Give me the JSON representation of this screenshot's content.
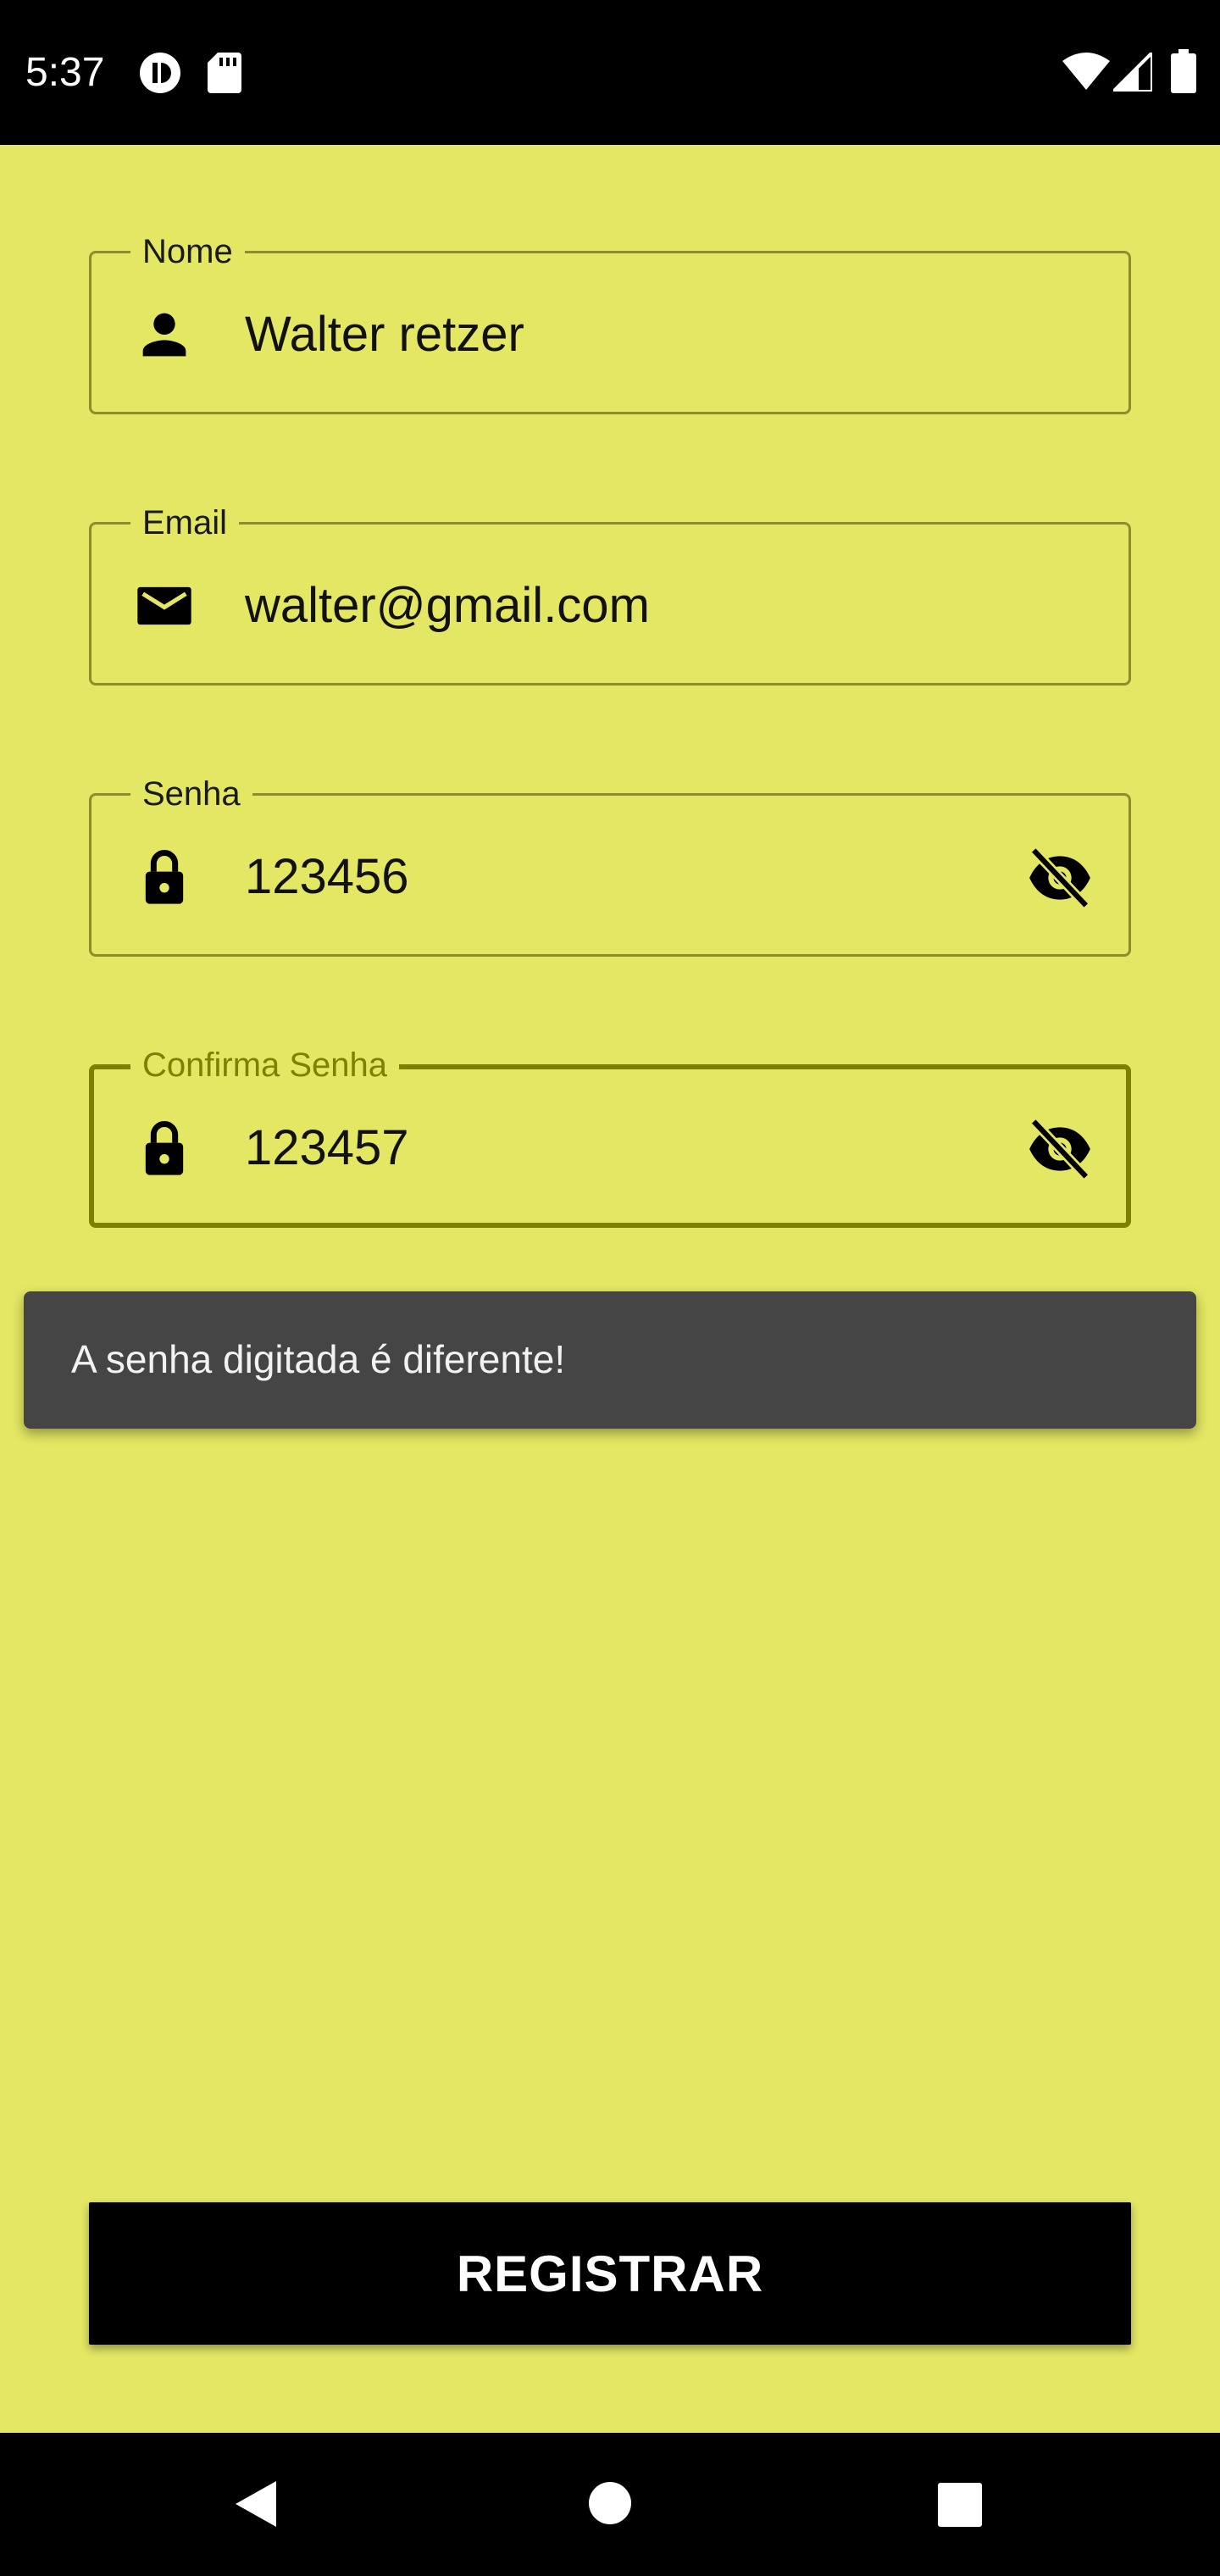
{
  "status_bar": {
    "time": "5:37",
    "icons": [
      "media-icon",
      "sd-card-icon",
      "wifi-icon",
      "signal-icon",
      "battery-icon"
    ]
  },
  "form": {
    "name": {
      "label": "Nome",
      "value": "Walter retzer",
      "icon": "person-icon"
    },
    "email": {
      "label": "Email",
      "value": "walter@gmail.com",
      "icon": "email-icon"
    },
    "password": {
      "label": "Senha",
      "value": "123456",
      "icon": "lock-icon",
      "toggle_icon": "visibility-off-icon"
    },
    "confirm_password": {
      "label": "Confirma Senha",
      "value": "123457",
      "icon": "lock-icon",
      "toggle_icon": "visibility-off-icon",
      "focused": true
    }
  },
  "snackbar": {
    "message": "A senha digitada é diferente!"
  },
  "register_button": {
    "label": "REGISTRAR"
  },
  "nav_bar": {
    "buttons": [
      "back-icon",
      "home-icon",
      "recents-icon"
    ]
  },
  "colors": {
    "background": "#e3e763",
    "field_border": "#8c8e2e",
    "focused_accent": "#7d7f00",
    "snackbar": "#454545",
    "button": "#000000"
  }
}
